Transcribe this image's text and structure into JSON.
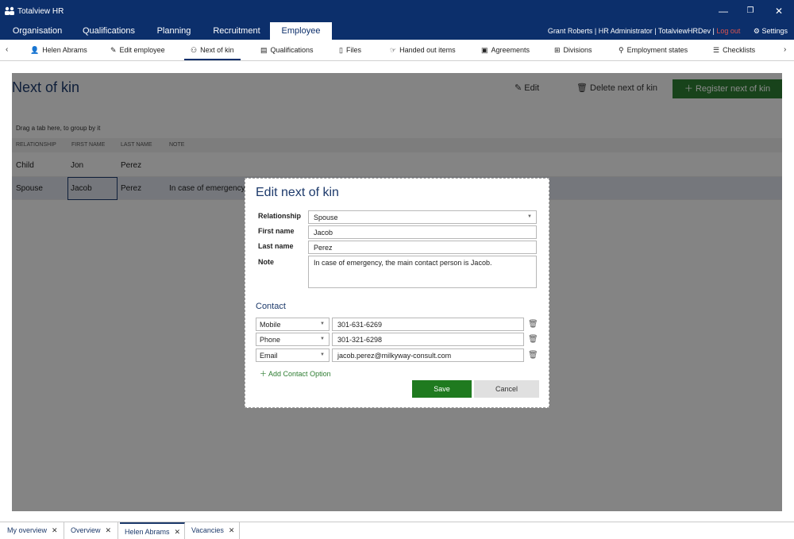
{
  "app": {
    "title": "Totalview HR"
  },
  "window_controls": {
    "minimize": "—",
    "maximize": "❐",
    "close": "✕"
  },
  "main_nav": {
    "tabs": [
      {
        "label": "Organisation"
      },
      {
        "label": "Qualifications"
      },
      {
        "label": "Planning"
      },
      {
        "label": "Recruitment"
      },
      {
        "label": "Employee"
      }
    ],
    "active_tab": "Employee"
  },
  "user_bar": {
    "user": "Grant Roberts",
    "role": "HR Administrator",
    "instance": "TotalviewHRDev",
    "logout": "Log out",
    "settings": "Settings"
  },
  "sub_nav": {
    "items": [
      {
        "label": "Helen Abrams",
        "icon": "person-icon"
      },
      {
        "label": "Edit employee",
        "icon": "pencil-icon"
      },
      {
        "label": "Next of kin",
        "icon": "people-icon"
      },
      {
        "label": "Qualifications",
        "icon": "certificate-icon"
      },
      {
        "label": "Files",
        "icon": "file-icon"
      },
      {
        "label": "Handed out items",
        "icon": "hand-icon"
      },
      {
        "label": "Agreements",
        "icon": "document-icon"
      },
      {
        "label": "Divisions",
        "icon": "hierarchy-icon"
      },
      {
        "label": "Employment states",
        "icon": "state-icon"
      },
      {
        "label": "Checklists",
        "icon": "checklist-icon"
      }
    ],
    "active_item": "Next of kin",
    "arrows": {
      "prev": "‹",
      "next": "›"
    }
  },
  "page": {
    "title": "Next of kin",
    "actions": {
      "edit": "Edit",
      "delete": "Delete next of kin",
      "register": "Register next of kin"
    },
    "group_hint": "Drag a tab here, to group by it"
  },
  "grid": {
    "columns": [
      "RELATIONSHIP",
      "FIRST NAME",
      "LAST NAME",
      "NOTE"
    ],
    "rows": [
      {
        "relationship": "Child",
        "first_name": "Jon",
        "last_name": "Perez",
        "note": ""
      },
      {
        "relationship": "Spouse",
        "first_name": "Jacob",
        "last_name": "Perez",
        "note": "In case of emergency, t"
      }
    ],
    "selected_row": 1
  },
  "dialog": {
    "title": "Edit next of kin",
    "fields": {
      "relationship": {
        "label": "Relationship",
        "value": "Spouse"
      },
      "first_name": {
        "label": "First name",
        "value": "Jacob"
      },
      "last_name": {
        "label": "Last name",
        "value": "Perez"
      },
      "note": {
        "label": "Note",
        "value": "In case of emergency, the main contact person is Jacob."
      }
    },
    "contact": {
      "title": "Contact",
      "options": [
        {
          "type": "Mobile",
          "value": "301-631-6269"
        },
        {
          "type": "Phone",
          "value": "301-321-6298"
        },
        {
          "type": "Email",
          "value": "jacob.perez@milkyway-consult.com"
        }
      ],
      "add_label": "Add Contact Option"
    },
    "save": "Save",
    "cancel": "Cancel"
  },
  "bottom_tabs": [
    {
      "label": "My overview"
    },
    {
      "label": "Overview"
    },
    {
      "label": "Helen Abrams"
    },
    {
      "label": "Vacancies"
    }
  ],
  "active_bottom_tab": "Helen Abrams",
  "colors": {
    "brand_navy": "#0c2f6b",
    "accent_green": "#2e7d32",
    "logout_red": "#d9534f"
  }
}
